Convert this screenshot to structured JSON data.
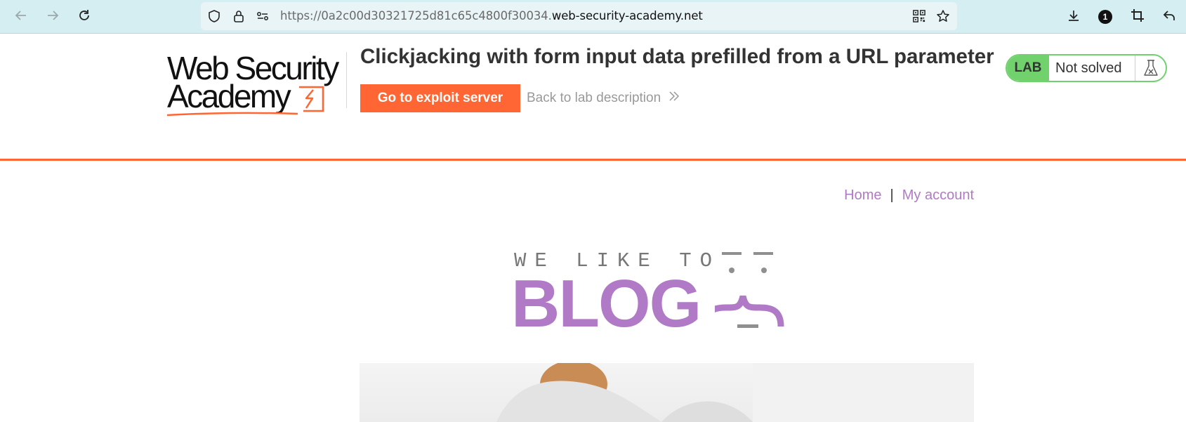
{
  "browser": {
    "url_prefix": "https://0a2c00d30321725d81c65c4800f30034.",
    "url_domain": "web-security-academy.net",
    "notification_count": "1",
    "icons": {
      "back": "arrow-left-icon",
      "forward": "arrow-right-icon",
      "reload": "reload-icon",
      "shield": "shield-icon",
      "lock": "lock-icon",
      "permissions": "permissions-icon",
      "qr": "qr-code-icon",
      "bookmark": "star-icon",
      "downloads": "download-icon",
      "crop": "crop-icon",
      "undo": "undo-icon"
    }
  },
  "academy": {
    "logo_line1": "Web Security",
    "logo_line2": "Academy",
    "lab_title": "Clickjacking with form input data prefilled from a URL parameter",
    "exploit_button": "Go to exploit server",
    "back_link": "Back to lab description",
    "lab_tag": "LAB",
    "lab_status": "Not solved",
    "accent_color": "#ff6633",
    "status_color": "#70d16d"
  },
  "blog": {
    "nav_home": "Home",
    "nav_separator": "|",
    "nav_account": "My account",
    "banner_top": "WE LIKE TO",
    "banner_word": "BLOG",
    "brand_color": "#b07ac6"
  }
}
